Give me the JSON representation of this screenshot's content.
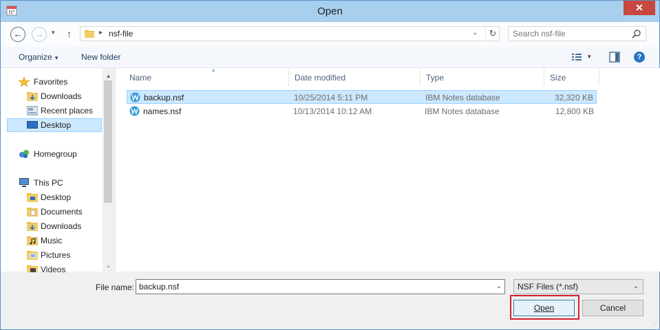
{
  "window": {
    "title": "Open",
    "close_glyph": "✕",
    "app_icon": "calendar-app-icon"
  },
  "address": {
    "path": "nsf-file",
    "separator": "▸",
    "dropdown": "⌄",
    "refresh": "↻",
    "back": "←",
    "forward": "→",
    "history": "▾",
    "up": "↑"
  },
  "search": {
    "placeholder": "Search nsf-file"
  },
  "toolbar": {
    "organize_label": "Organize",
    "organize_arrow": "▾",
    "new_folder_label": "New folder",
    "view_dropdown": "▾",
    "help": "?"
  },
  "nav": {
    "items": [
      {
        "label": "Favorites",
        "icon": "star-icon"
      },
      {
        "label": "Downloads",
        "icon": "downloads-folder-icon"
      },
      {
        "label": "Recent places",
        "icon": "recent-places-icon"
      },
      {
        "label": "Desktop",
        "icon": "desktop-icon",
        "selected": true
      },
      {
        "label": "Homegroup",
        "icon": "homegroup-icon"
      },
      {
        "label": "This PC",
        "icon": "computer-icon"
      },
      {
        "label": "Desktop",
        "icon": "desktop-folder-icon"
      },
      {
        "label": "Documents",
        "icon": "documents-folder-icon"
      },
      {
        "label": "Downloads",
        "icon": "downloads-folder-icon"
      },
      {
        "label": "Music",
        "icon": "music-folder-icon"
      },
      {
        "label": "Pictures",
        "icon": "pictures-folder-icon"
      },
      {
        "label": "Videos",
        "icon": "videos-folder-icon"
      }
    ],
    "scroll_up": "▴",
    "scroll_down": "⌄"
  },
  "columns": {
    "name": "Name",
    "date": "Date modified",
    "type": "Type",
    "size": "Size",
    "sort_arrow": "▴"
  },
  "files": [
    {
      "name": "backup.nsf",
      "date": "10/25/2014 5:11 PM",
      "type": "IBM Notes database",
      "size": "32,320 KB",
      "selected": true
    },
    {
      "name": "names.nsf",
      "date": "10/13/2014 10:12 AM",
      "type": "IBM Notes database",
      "size": "12,800 KB"
    }
  ],
  "bottom": {
    "file_name_label": "File name:",
    "file_name_value": "backup.nsf",
    "filter_value": "NSF Files (*.nsf)",
    "dropdown": "⌄",
    "open_label": "Open",
    "cancel_label": "Cancel",
    "grip": "⋰"
  },
  "colors": {
    "selection_bg": "#cce8ff",
    "selection_border": "#99d1ff",
    "titlebar": "#a8cfee",
    "close_red": "#c7483f",
    "highlight_red": "#d0202a"
  }
}
